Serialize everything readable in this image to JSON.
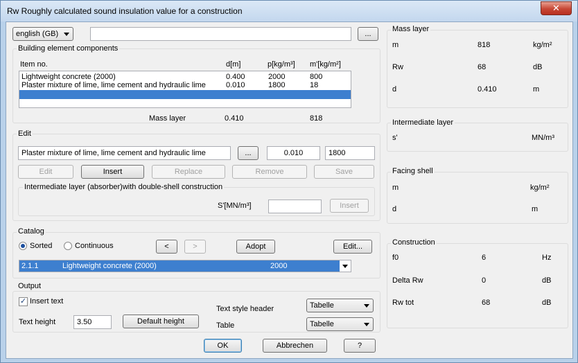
{
  "window": {
    "title": "Rw Roughly calculated sound insulation value for a construction",
    "close_glyph": "✕"
  },
  "top": {
    "language": "english (GB)",
    "path_value": "",
    "browse_label": "..."
  },
  "components": {
    "group_label": "Building element components",
    "headers": {
      "item": "Item no.",
      "d": "d[m]",
      "p": "p[kg/m³]",
      "m": "m'[kg/m²]"
    },
    "rows": [
      {
        "name": "Lightweight concrete (2000)",
        "d": "0.400",
        "p": "2000",
        "m": "800"
      },
      {
        "name": "Plaster mixture of lime, lime cement and hydraulic lime",
        "d": "0.010",
        "p": "1800",
        "m": "18"
      }
    ],
    "mass_label": "Mass layer",
    "mass_d": "0.410",
    "mass_m": "818"
  },
  "edit": {
    "group_label": "Edit",
    "material": "Plaster mixture of lime, lime cement and hydraulic lime",
    "browse_label": "...",
    "d_value": "0.010",
    "p_value": "1800",
    "buttons": {
      "edit": "Edit",
      "insert": "Insert",
      "replace": "Replace",
      "remove": "Remove",
      "save": "Save"
    },
    "intermediate_group": "Intermediate layer (absorber)with double-shell construction",
    "s_label": "S'[MN/m³]",
    "s_value": "",
    "s_insert": "Insert"
  },
  "catalog": {
    "group_label": "Catalog",
    "sorted": "Sorted",
    "continuous": "Continuous",
    "prev": "<",
    "next": ">",
    "adopt": "Adopt",
    "edit": "Edit...",
    "selected": {
      "code": "2.1.1",
      "name": "Lightweight concrete (2000)",
      "value": "2000"
    }
  },
  "output": {
    "group_label": "Output",
    "insert_text": "Insert text",
    "check_mark": "✓",
    "text_height_label": "Text height",
    "text_height": "3.50",
    "default_height": "Default height",
    "style_header_label": "Text style header",
    "style_header": "Tabelle",
    "table_label": "Table",
    "table": "Tabelle"
  },
  "footer": {
    "ok": "OK",
    "cancel": "Abbrechen",
    "help": "?"
  },
  "mass_layer": {
    "group_label": "Mass layer",
    "m_label": "m",
    "m_value": "818",
    "m_unit": "kg/m²",
    "rw_label": "Rw",
    "rw_value": "68",
    "rw_unit": "dB",
    "d_label": "d",
    "d_value": "0.410",
    "d_unit": "m"
  },
  "intermediate": {
    "group_label": "Intermediate layer",
    "s_label": "s'",
    "s_unit": "MN/m³"
  },
  "facing": {
    "group_label": "Facing shell",
    "m_label": "m",
    "m_unit": "kg/m²",
    "d_label": "d",
    "d_unit": "m"
  },
  "construction": {
    "group_label": "Construction",
    "f0_label": "f0",
    "f0_value": "6",
    "f0_unit": "Hz",
    "delta_label": "Delta Rw",
    "delta_value": "0",
    "delta_unit": "dB",
    "tot_label": "Rw tot",
    "tot_value": "68",
    "tot_unit": "dB"
  }
}
